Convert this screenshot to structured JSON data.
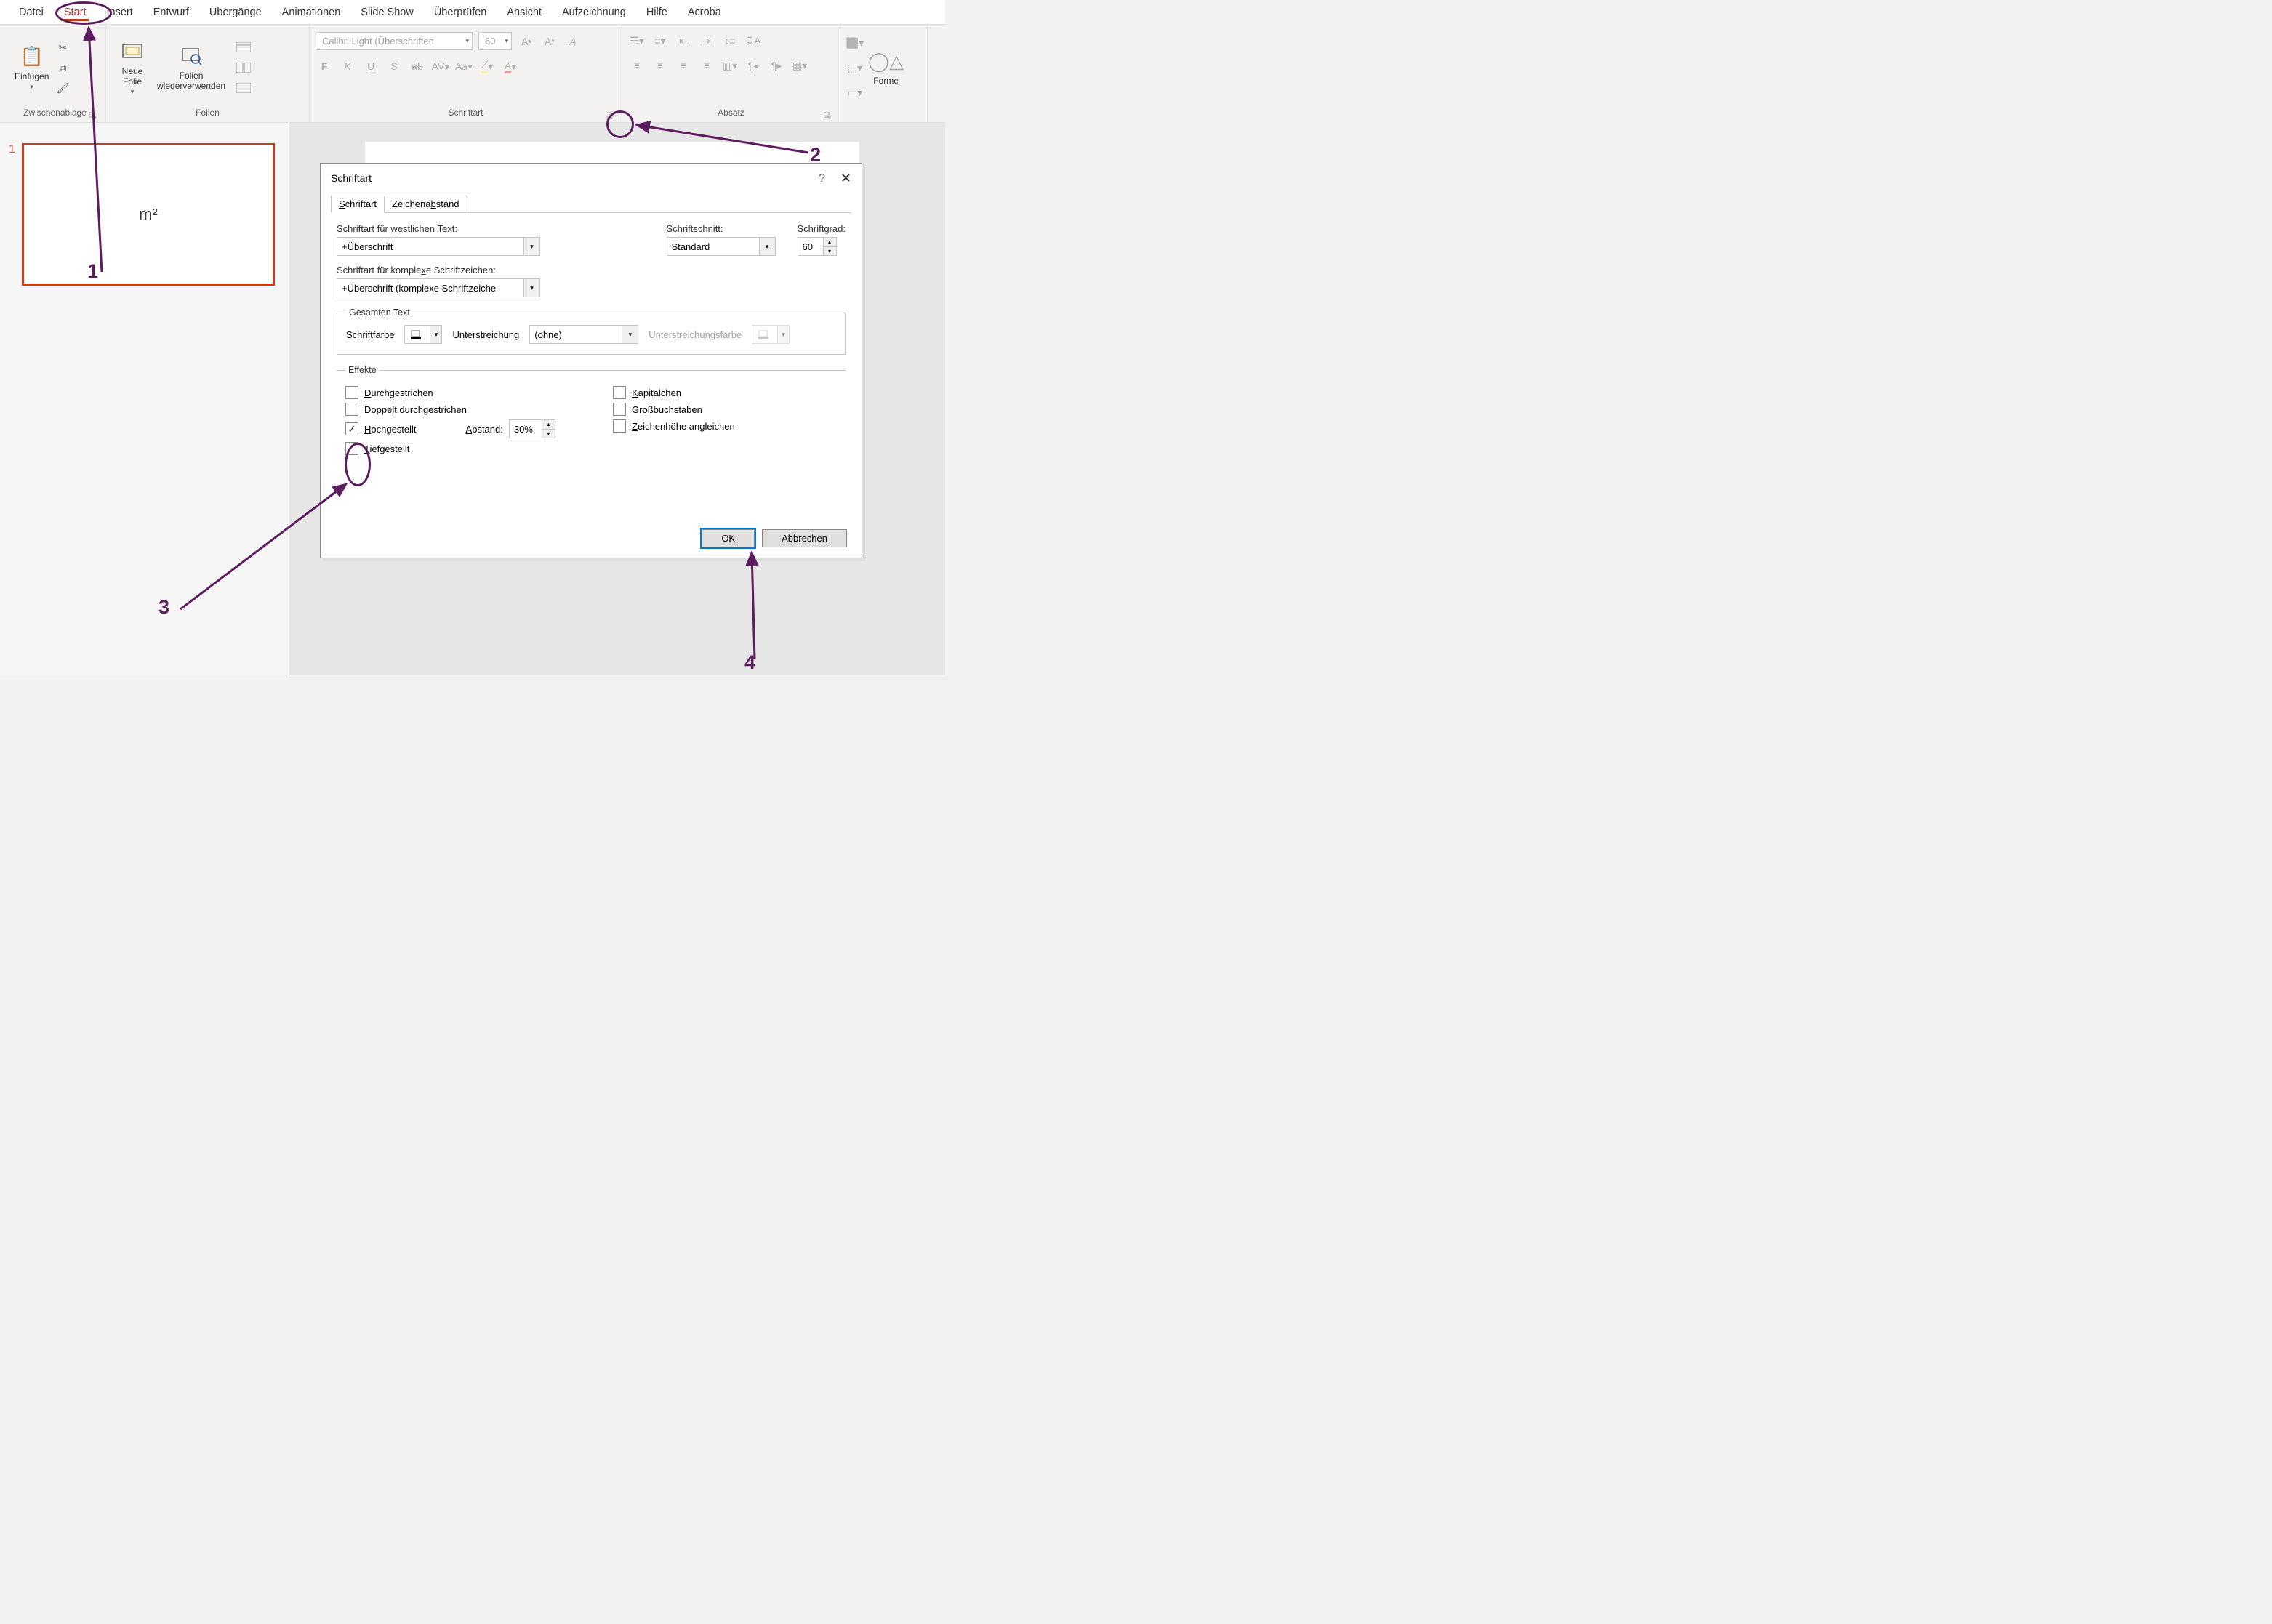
{
  "tabs": [
    "Datei",
    "Start",
    "Insert",
    "Entwurf",
    "Übergänge",
    "Animationen",
    "Slide Show",
    "Überprüfen",
    "Ansicht",
    "Aufzeichnung",
    "Hilfe",
    "Acroba"
  ],
  "activeTab": "Start",
  "ribbon": {
    "clipboard": {
      "paste": "Einfügen",
      "groupLabel": "Zwischenablage"
    },
    "slides": {
      "newSlide": "Neue\nFolie",
      "reuse": "Folien\nwiederverwenden",
      "groupLabel": "Folien"
    },
    "font": {
      "placeholder": "Calibri Light (Überschriften",
      "size": "60",
      "groupLabel": "Schriftart",
      "btns": [
        "F",
        "K",
        "U",
        "S",
        "ab",
        "AV",
        "Aa"
      ]
    },
    "paragraph": {
      "groupLabel": "Absatz"
    },
    "drawing": {
      "label": "Forme"
    }
  },
  "thumb": {
    "num": "1",
    "text": "m²"
  },
  "dialog": {
    "title": "Schriftart",
    "tabs": [
      "Schriftart",
      "Zeichenabstand"
    ],
    "westernLabel": "Schriftart für westlichen Text:",
    "westernValue": "+Überschrift",
    "styleLabel": "Schriftschnitt:",
    "styleValue": "Standard",
    "sizeLabel": "Schriftgrad:",
    "sizeValue": "60",
    "complexLabel": "Schriftart für komplexe Schriftzeichen:",
    "complexValue": "+Überschrift (komplexe Schriftzeiche",
    "allText": "Gesamten Text",
    "fontColor": "Schriftfarbe",
    "underline": "Unterstreichung",
    "underlineValue": "(ohne)",
    "underlineColor": "Unterstreichungsfarbe",
    "effects": "Effekte",
    "strikethrough": "Durchgestrichen",
    "dblStrike": "Doppelt durchgestrichen",
    "superscript": "Hochgestellt",
    "subscript": "Tiefgestellt",
    "offset": "Abstand:",
    "offsetValue": "30%",
    "smallCaps": "Kapitälchen",
    "allCaps": "Großbuchstaben",
    "equalize": "Zeichenhöhe angleichen",
    "ok": "OK",
    "cancel": "Abbrechen"
  },
  "annotations": {
    "1": "1",
    "2": "2",
    "3": "3",
    "4": "4"
  }
}
